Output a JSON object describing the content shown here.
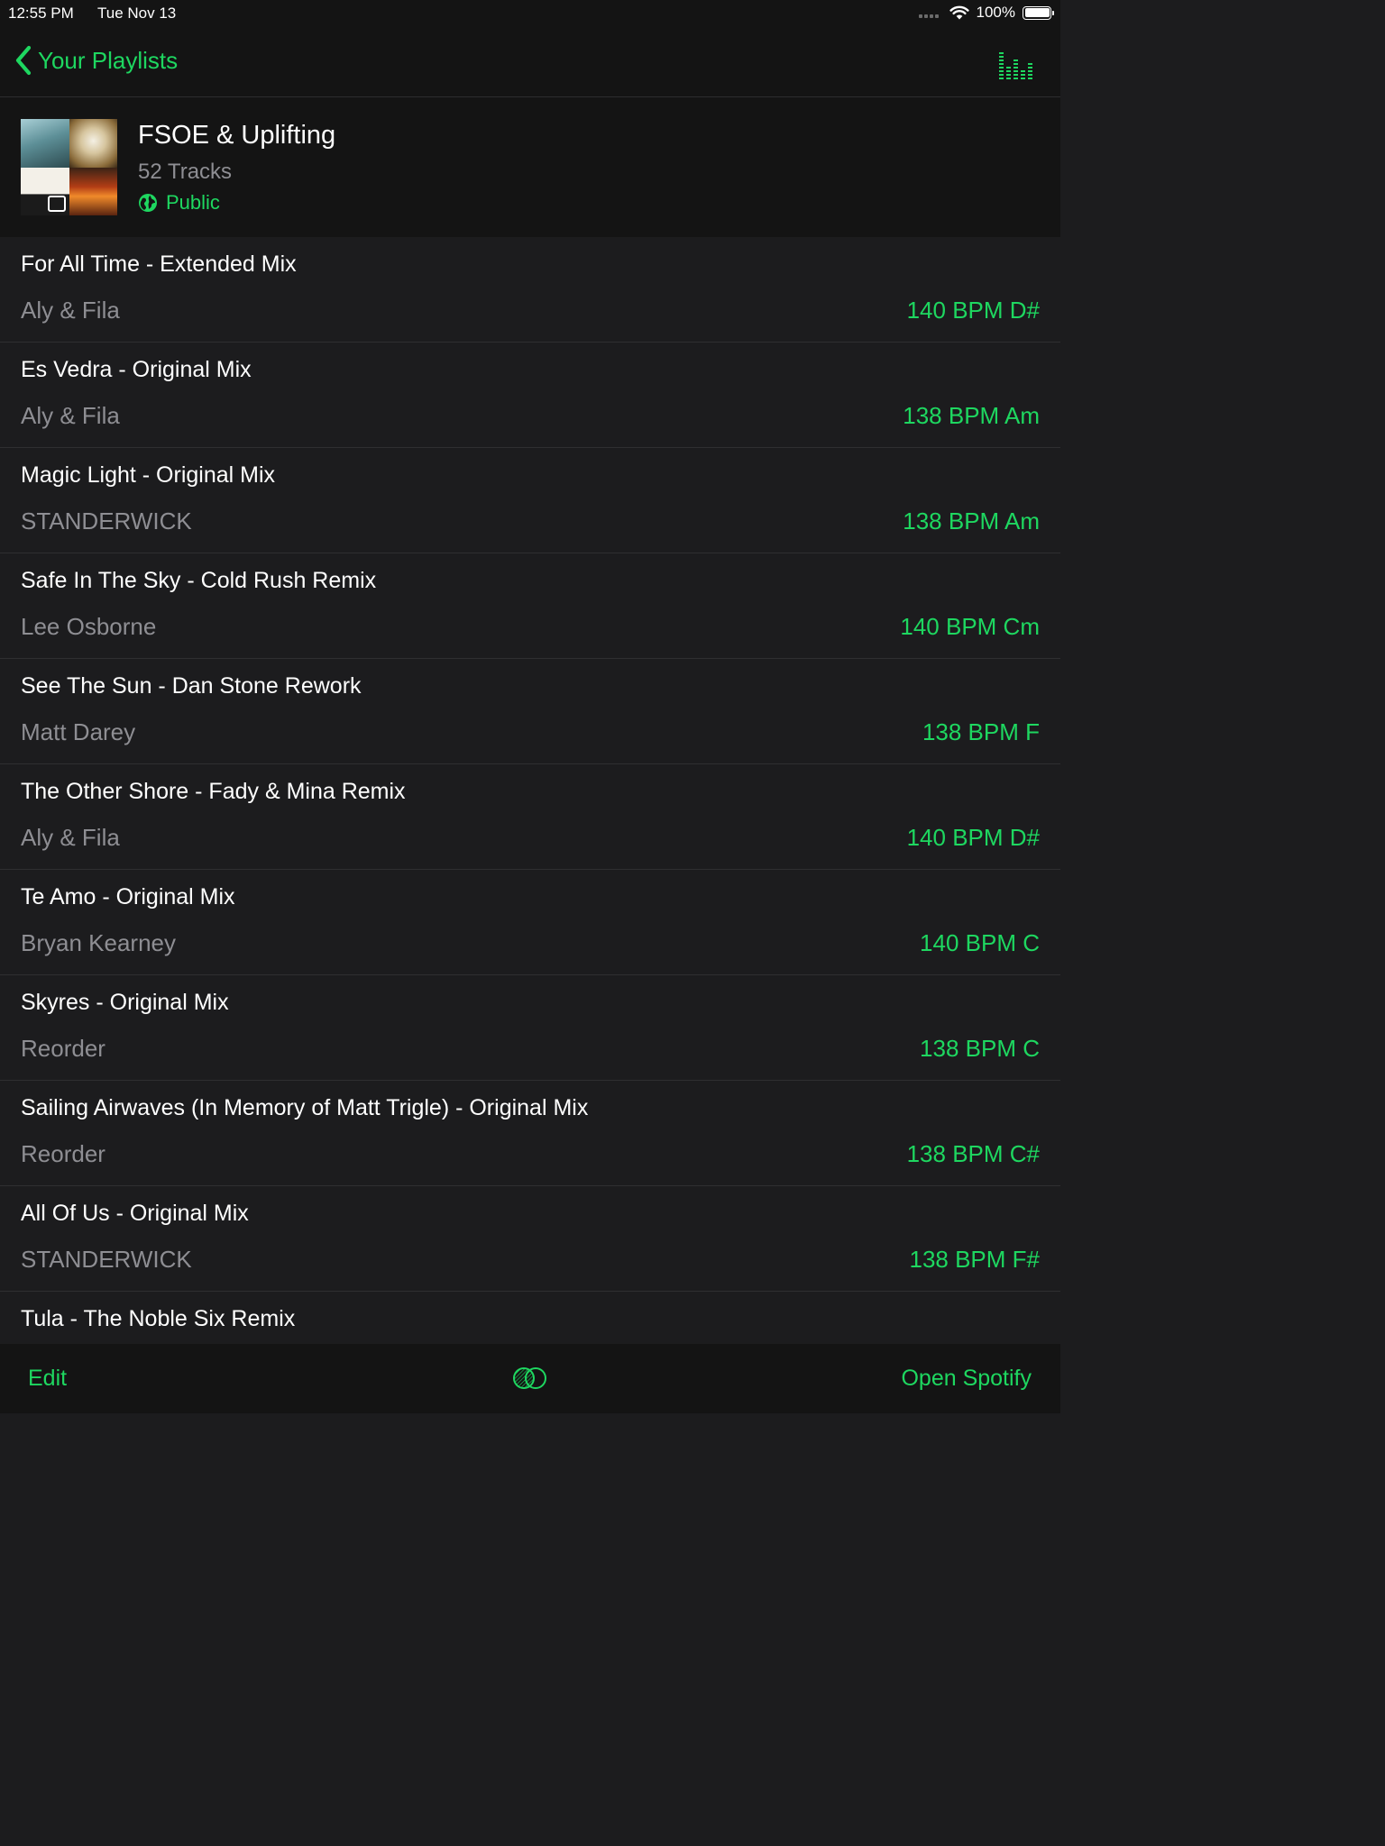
{
  "status_bar": {
    "time": "12:55 PM",
    "date": "Tue Nov 13",
    "battery": "100%",
    "battery_level": 1.0,
    "icons": [
      "cellular-dots-icon",
      "wifi-icon",
      "battery-icon"
    ]
  },
  "nav": {
    "back_label": "Your Playlists",
    "back_icon": "chevron-left-icon",
    "right_icon": "equalizer-icon"
  },
  "playlist": {
    "title": "FSOE & Uplifting",
    "track_count": "52 Tracks",
    "visibility": "Public",
    "visibility_icon": "globe-icon"
  },
  "tracks": [
    {
      "title": "For All Time - Extended Mix",
      "artist": "Aly & Fila",
      "meta": "140 BPM D#"
    },
    {
      "title": "Es Vedra - Original Mix",
      "artist": "Aly & Fila",
      "meta": "138 BPM Am"
    },
    {
      "title": "Magic Light - Original Mix",
      "artist": "STANDERWICK",
      "meta": "138 BPM Am"
    },
    {
      "title": "Safe In The Sky - Cold Rush Remix",
      "artist": "Lee Osborne",
      "meta": "140 BPM Cm"
    },
    {
      "title": "See The Sun - Dan Stone Rework",
      "artist": "Matt Darey",
      "meta": "138 BPM F"
    },
    {
      "title": "The Other Shore - Fady & Mina Remix",
      "artist": "Aly & Fila",
      "meta": "140 BPM D#"
    },
    {
      "title": "Te Amo - Original Mix",
      "artist": "Bryan Kearney",
      "meta": "140 BPM C"
    },
    {
      "title": "Skyres - Original Mix",
      "artist": "Reorder",
      "meta": "138 BPM C"
    },
    {
      "title": "Sailing Airwaves (In Memory of Matt Trigle) - Original Mix",
      "artist": "Reorder",
      "meta": "138 BPM C#"
    },
    {
      "title": "All Of Us - Original Mix",
      "artist": "STANDERWICK",
      "meta": "138 BPM F#"
    },
    {
      "title": "Tula - The Noble Six Remix",
      "artist": "",
      "meta": ""
    }
  ],
  "toolbar": {
    "edit_label": "Edit",
    "center_icon": "mix-circles-icon",
    "open_label": "Open Spotify"
  },
  "colors": {
    "accent": "#1ed760",
    "background": "#1c1c1e",
    "bar_background": "#141414",
    "primary_text": "#ffffff",
    "secondary_text": "#8e8e93"
  }
}
